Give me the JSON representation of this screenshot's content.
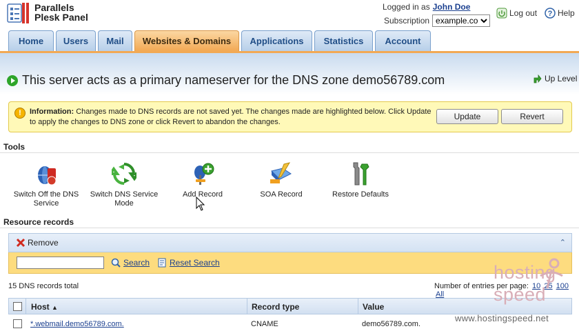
{
  "header": {
    "logo_line1": "Parallels",
    "logo_line2": "Plesk Panel",
    "logged_in_label": "Logged in as",
    "user_name": "John Doe",
    "subscription_label": "Subscription",
    "subscription_value": "example.com",
    "logout_label": "Log out",
    "help_label": "Help"
  },
  "tabs": [
    {
      "label": "Home",
      "active": false
    },
    {
      "label": "Users",
      "active": false
    },
    {
      "label": "Mail",
      "active": false
    },
    {
      "label": "Websites & Domains",
      "active": true
    },
    {
      "label": "Applications",
      "active": false
    },
    {
      "label": "Statistics",
      "active": false
    },
    {
      "label": "Account",
      "active": false
    }
  ],
  "page": {
    "title": "This server acts as a primary nameserver for the DNS zone demo56789.com",
    "up_level": "Up Level"
  },
  "info": {
    "label": "Information:",
    "text": "Changes made to DNS records are not saved yet. The changes made are highlighted below. Click Update to apply the changes to DNS zone or click Revert to abandon the changes.",
    "update_button": "Update",
    "revert_button": "Revert"
  },
  "tools": {
    "heading": "Tools",
    "items": [
      {
        "line1": "Switch Off the DNS",
        "line2": "Service",
        "icon": "dns-off-icon"
      },
      {
        "line1": "Switch DNS Service",
        "line2": "Mode",
        "icon": "dns-mode-icon"
      },
      {
        "line1": "Add Record",
        "line2": "",
        "icon": "add-record-icon"
      },
      {
        "line1": "SOA Record",
        "line2": "",
        "icon": "soa-record-icon"
      },
      {
        "line1": "Restore Defaults",
        "line2": "",
        "icon": "restore-defaults-icon"
      }
    ]
  },
  "records": {
    "heading": "Resource records",
    "remove_label": "Remove",
    "search_label": "Search",
    "reset_search_label": "Reset Search",
    "search_value": "",
    "total": "15 DNS records total",
    "per_page_label": "Number of entries per page:",
    "per_page_options": [
      "10",
      "25",
      "100",
      "All"
    ],
    "columns": [
      "Host",
      "Record type",
      "Value"
    ],
    "rows": [
      {
        "host": "*.webmail.demo56789.com.",
        "type": "CNAME",
        "value": "demo56789.com."
      }
    ]
  },
  "watermark": {
    "line1": "hosting",
    "line2": "speed",
    "url": "www.hostingspeed.net"
  },
  "colors": {
    "active_tab": "#f2a954",
    "tab": "#b7cfe9",
    "info_bg": "#fff9b8",
    "search_bar": "#fddc7f",
    "link": "#1a3f8f"
  }
}
